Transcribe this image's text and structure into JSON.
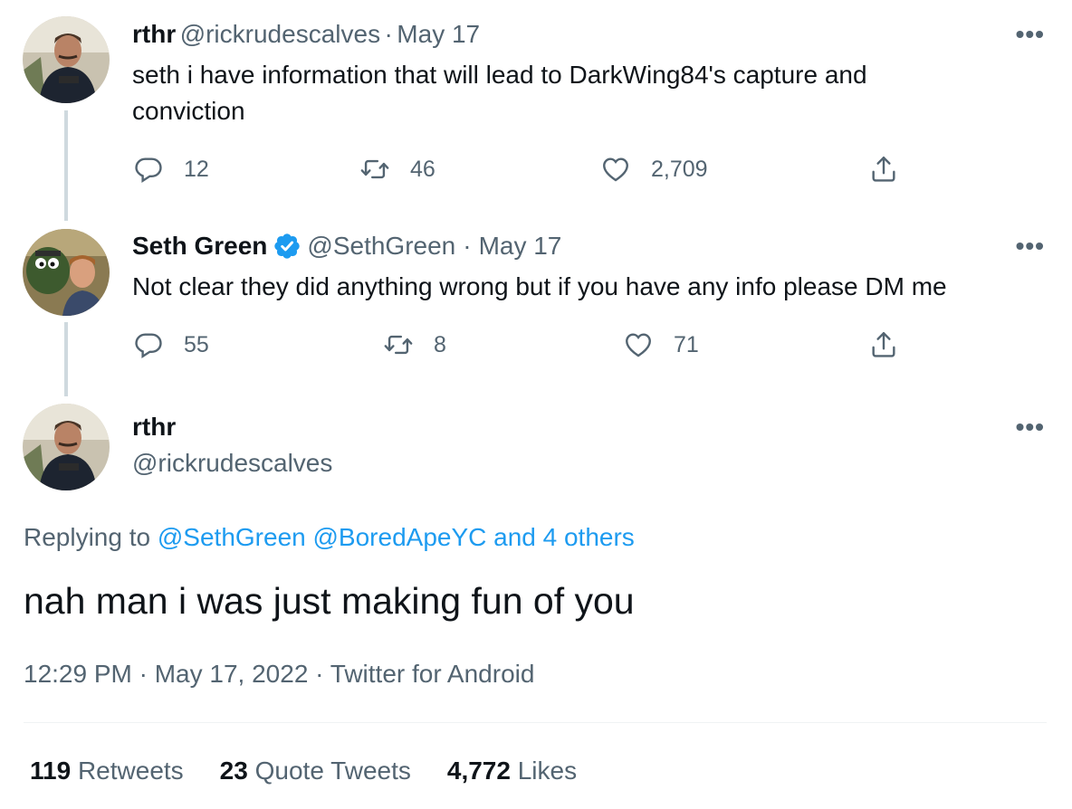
{
  "tweets": [
    {
      "name": "rthr",
      "handle": "@rickrudescalves",
      "dot": "·",
      "date": "May 17",
      "text": "seth i have information that will lead to DarkWing84's capture and conviction",
      "replies": "12",
      "retweets": "46",
      "likes": "2,709"
    },
    {
      "name": "Seth Green",
      "handle": "@SethGreen",
      "dot": "·",
      "date": "May 17",
      "text": "Not clear they did anything wrong but if you have any info please DM me",
      "replies": "55",
      "retweets": "8",
      "likes": "71"
    }
  ],
  "main_tweet": {
    "name": "rthr",
    "handle": "@rickrudescalves",
    "replying_prefix": "Replying to",
    "replying_to": "@SethGreen @BoredApeYC and 4 others",
    "text": "nah man i was just making fun of you",
    "timestamp": "12:29 PM · May 17, 2022 · Twitter for Android"
  },
  "stats": {
    "retweets_count": "119",
    "retweets_label": "Retweets",
    "quotes_count": "23",
    "quotes_label": "Quote Tweets",
    "likes_count": "4,772",
    "likes_label": "Likes"
  },
  "more_label": "•••",
  "icons": [
    "reply-icon",
    "retweet-icon",
    "like-icon",
    "share-icon",
    "verified-badge-icon",
    "more-icon"
  ],
  "colors": {
    "link": "#1d9bf0",
    "secondary": "#536471",
    "verified": "#1d9bf0",
    "thread_line": "#cfd9de"
  }
}
